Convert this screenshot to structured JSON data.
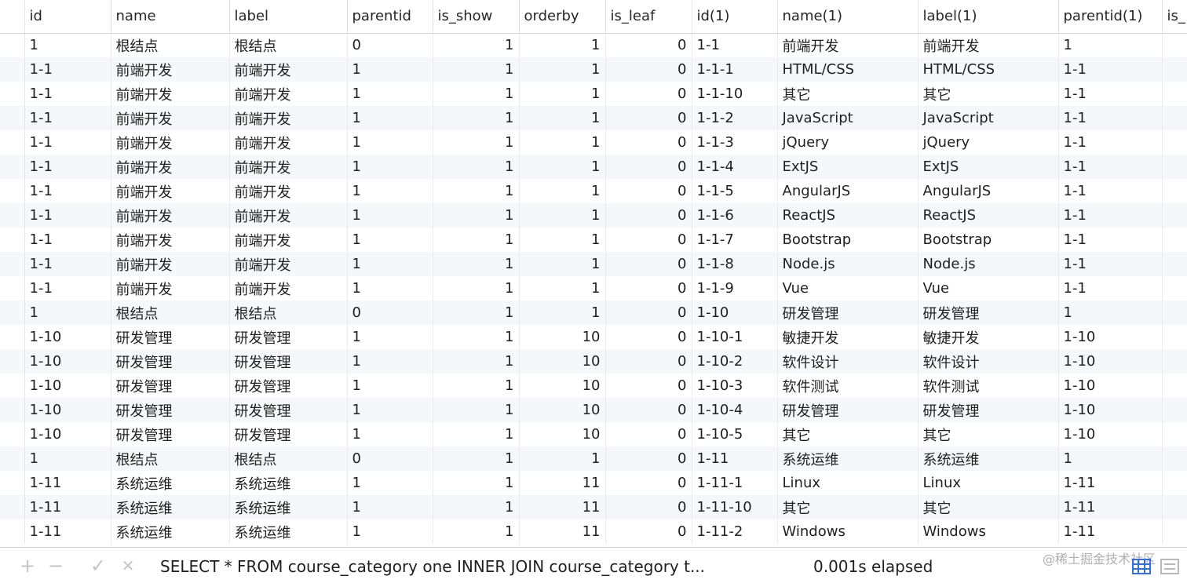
{
  "grid": {
    "columns": [
      {
        "label": "id",
        "align": "left"
      },
      {
        "label": "name",
        "align": "left"
      },
      {
        "label": "label",
        "align": "left"
      },
      {
        "label": "parentid",
        "align": "left"
      },
      {
        "label": "is_show",
        "align": "right"
      },
      {
        "label": "orderby",
        "align": "right"
      },
      {
        "label": "is_leaf",
        "align": "right"
      },
      {
        "label": "id(1)",
        "align": "left"
      },
      {
        "label": "name(1)",
        "align": "left"
      },
      {
        "label": "label(1)",
        "align": "left"
      },
      {
        "label": "parentid(1)",
        "align": "left"
      },
      {
        "label": "is_",
        "align": "left"
      }
    ],
    "rows": [
      [
        "1",
        "根结点",
        "根结点",
        "0",
        "1",
        "1",
        "0",
        "1-1",
        "前端开发",
        "前端开发",
        "1",
        ""
      ],
      [
        "1-1",
        "前端开发",
        "前端开发",
        "1",
        "1",
        "1",
        "0",
        "1-1-1",
        "HTML/CSS",
        "HTML/CSS",
        "1-1",
        ""
      ],
      [
        "1-1",
        "前端开发",
        "前端开发",
        "1",
        "1",
        "1",
        "0",
        "1-1-10",
        "其它",
        "其它",
        "1-1",
        ""
      ],
      [
        "1-1",
        "前端开发",
        "前端开发",
        "1",
        "1",
        "1",
        "0",
        "1-1-2",
        "JavaScript",
        "JavaScript",
        "1-1",
        ""
      ],
      [
        "1-1",
        "前端开发",
        "前端开发",
        "1",
        "1",
        "1",
        "0",
        "1-1-3",
        "jQuery",
        "jQuery",
        "1-1",
        ""
      ],
      [
        "1-1",
        "前端开发",
        "前端开发",
        "1",
        "1",
        "1",
        "0",
        "1-1-4",
        "ExtJS",
        "ExtJS",
        "1-1",
        ""
      ],
      [
        "1-1",
        "前端开发",
        "前端开发",
        "1",
        "1",
        "1",
        "0",
        "1-1-5",
        "AngularJS",
        "AngularJS",
        "1-1",
        ""
      ],
      [
        "1-1",
        "前端开发",
        "前端开发",
        "1",
        "1",
        "1",
        "0",
        "1-1-6",
        "ReactJS",
        "ReactJS",
        "1-1",
        ""
      ],
      [
        "1-1",
        "前端开发",
        "前端开发",
        "1",
        "1",
        "1",
        "0",
        "1-1-7",
        "Bootstrap",
        "Bootstrap",
        "1-1",
        ""
      ],
      [
        "1-1",
        "前端开发",
        "前端开发",
        "1",
        "1",
        "1",
        "0",
        "1-1-8",
        "Node.js",
        "Node.js",
        "1-1",
        ""
      ],
      [
        "1-1",
        "前端开发",
        "前端开发",
        "1",
        "1",
        "1",
        "0",
        "1-1-9",
        "Vue",
        "Vue",
        "1-1",
        ""
      ],
      [
        "1",
        "根结点",
        "根结点",
        "0",
        "1",
        "1",
        "0",
        "1-10",
        "研发管理",
        "研发管理",
        "1",
        ""
      ],
      [
        "1-10",
        "研发管理",
        "研发管理",
        "1",
        "1",
        "10",
        "0",
        "1-10-1",
        "敏捷开发",
        "敏捷开发",
        "1-10",
        ""
      ],
      [
        "1-10",
        "研发管理",
        "研发管理",
        "1",
        "1",
        "10",
        "0",
        "1-10-2",
        "软件设计",
        "软件设计",
        "1-10",
        ""
      ],
      [
        "1-10",
        "研发管理",
        "研发管理",
        "1",
        "1",
        "10",
        "0",
        "1-10-3",
        "软件测试",
        "软件测试",
        "1-10",
        ""
      ],
      [
        "1-10",
        "研发管理",
        "研发管理",
        "1",
        "1",
        "10",
        "0",
        "1-10-4",
        "研发管理",
        "研发管理",
        "1-10",
        ""
      ],
      [
        "1-10",
        "研发管理",
        "研发管理",
        "1",
        "1",
        "10",
        "0",
        "1-10-5",
        "其它",
        "其它",
        "1-10",
        ""
      ],
      [
        "1",
        "根结点",
        "根结点",
        "0",
        "1",
        "1",
        "0",
        "1-11",
        "系统运维",
        "系统运维",
        "1",
        ""
      ],
      [
        "1-11",
        "系统运维",
        "系统运维",
        "1",
        "1",
        "11",
        "0",
        "1-11-1",
        "Linux",
        "Linux",
        "1-11",
        ""
      ],
      [
        "1-11",
        "系统运维",
        "系统运维",
        "1",
        "1",
        "11",
        "0",
        "1-11-10",
        "其它",
        "其它",
        "1-11",
        ""
      ],
      [
        "1-11",
        "系统运维",
        "系统运维",
        "1",
        "1",
        "11",
        "0",
        "1-11-2",
        "Windows",
        "Windows",
        "1-11",
        ""
      ]
    ]
  },
  "statusbar": {
    "add_icon": "+",
    "remove_icon": "−",
    "apply_icon": "✓",
    "discard_icon": "✕",
    "query_text": "SELECT *  FROM course_category one INNER JOIN course_category t...",
    "elapsed": "0.001s elapsed",
    "watermark": "@稀土掘金技术社区",
    "grid_view_icon": "grid-view-icon",
    "form_view_icon": "form-view-icon",
    "active_color": "#2f6fe0",
    "inactive_color": "#b8b8b8"
  }
}
